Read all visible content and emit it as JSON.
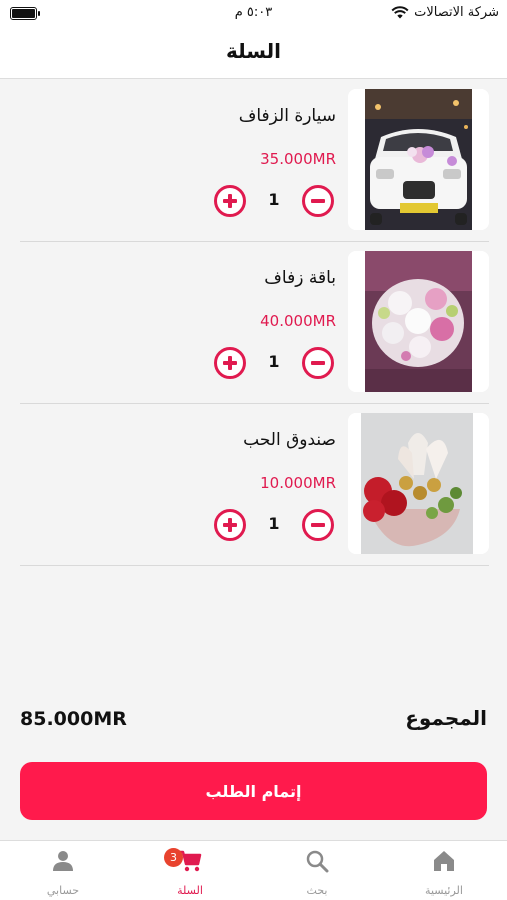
{
  "status_bar": {
    "carrier": "شركة الاتصالات",
    "time": "٥:٠٣ م"
  },
  "header": {
    "title": "السلة"
  },
  "cart": {
    "items": [
      {
        "name": "سيارة الزفاف",
        "price": "35.000MR",
        "qty": "1",
        "image": "wedding-car-photo"
      },
      {
        "name": "باقة زفاف",
        "price": "40.000MR",
        "qty": "1",
        "image": "wedding-bouquet-photo"
      },
      {
        "name": "صندوق الحب",
        "price": "10.000MR",
        "qty": "1",
        "image": "love-box-photo"
      }
    ]
  },
  "summary": {
    "total_label": "المجموع",
    "total_value": "85.000MR",
    "checkout_label": "إتمام الطلب"
  },
  "tabbar": {
    "tabs": [
      {
        "label": "الرئيسية",
        "icon": "home-icon"
      },
      {
        "label": "بحث",
        "icon": "search-icon"
      },
      {
        "label": "السلة",
        "icon": "cart-icon",
        "badge": "3",
        "active": true
      },
      {
        "label": "حسابي",
        "icon": "user-icon"
      }
    ]
  },
  "colors": {
    "accent": "#e01a4f",
    "checkout": "#ff1a4c",
    "badge": "#e8432e"
  }
}
